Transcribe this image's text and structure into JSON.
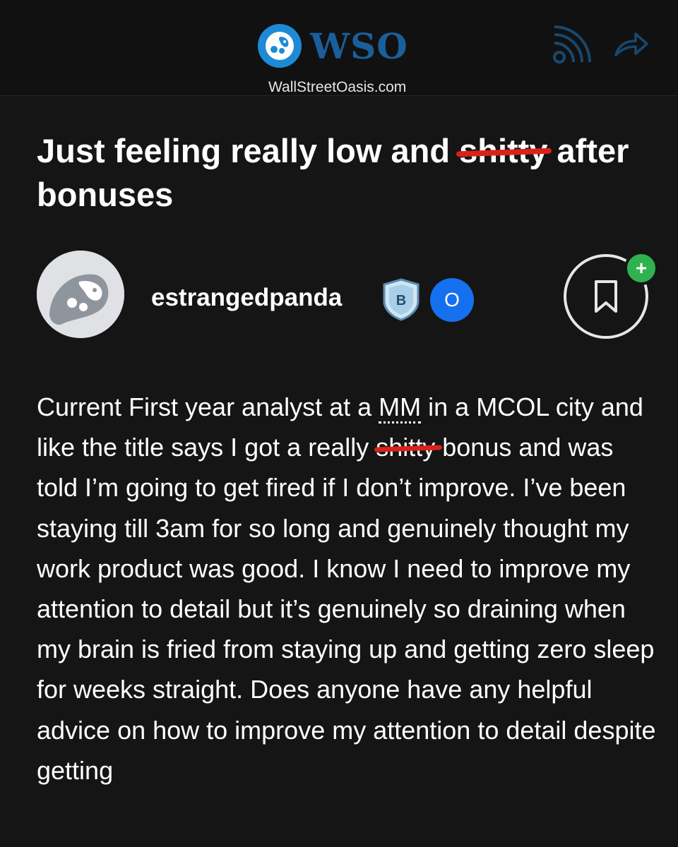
{
  "header": {
    "logo_text": "WSO",
    "tagline": "WallStreetOasis.com",
    "icons": {
      "rss": "rss-feed-icon",
      "share": "share-arrow-icon"
    },
    "brand_color": "#1a5f9c"
  },
  "post": {
    "title_before": "Just feeling really low and ",
    "title_struck": "shitty",
    "title_after": " after bonuses",
    "author": {
      "username": "estrangedpanda",
      "badge_letter": "B",
      "status_letter": "O"
    },
    "body_part1": "Current First year analyst at a ",
    "body_abbr": "MM",
    "body_part2": " in a MCOL city and like the title says I got a really ",
    "body_struck": "shitty",
    "body_part3": " bonus and was told I’m going to get fired if I don’t improve. I’ve been staying till 3am for so long and genuinely thought my work product was good. I know I need to improve my attention to detail but it’s genuinely so draining when my brain is fried from staying up and getting zero sleep for weeks straight. Does anyone have any helpful advice on how to improve my attention to detail despite getting"
  },
  "colors": {
    "background": "#151515",
    "strike": "#d8231a",
    "status_blue": "#1570ef",
    "add_green": "#2fb24f"
  }
}
